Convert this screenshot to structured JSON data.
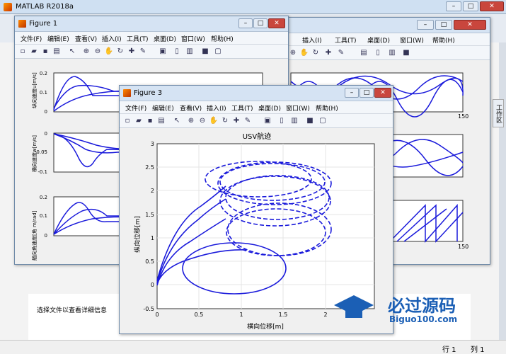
{
  "main": {
    "title": "MATLAB R2018a",
    "status_row": "行 1",
    "status_col": "列 1",
    "select_hint": "选择文件以查看详细信息",
    "workspace_tab": "工作区"
  },
  "menus": [
    "文件(F)",
    "编辑(E)",
    "查看(V)",
    "插入(I)",
    "工具(T)",
    "桌面(D)",
    "窗口(W)",
    "帮助(H)"
  ],
  "fig1": {
    "title": "Figure 1",
    "ylabels": [
      "纵向速度u[m/s]",
      "横向速度w[m/s]",
      "艏向角速度[角 m/rad]"
    ],
    "ax1": {
      "ticks": [
        "0",
        "0.1",
        "0.2"
      ]
    },
    "ax2": {
      "ticks": [
        "0",
        "-0.05",
        "-0.1"
      ]
    },
    "ax3": {
      "ticks": [
        "0",
        "0.1",
        "0.2"
      ]
    },
    "x_end": "150"
  },
  "fig3": {
    "title": "Figure 3",
    "chart_data": {
      "type": "line",
      "title": "USV航迹",
      "xlabel": "横向位移[m]",
      "ylabel": "纵向位移[m]",
      "xlim": [
        0,
        2.2
      ],
      "ylim": [
        -0.5,
        3
      ],
      "xticks": [
        "0",
        "0.5",
        "1",
        "1.5",
        "2"
      ],
      "yticks": [
        "-0.5",
        "0",
        "0.5",
        "1",
        "1.5",
        "2",
        "2.5",
        "3"
      ],
      "grid": true
    }
  },
  "watermark": {
    "text": "必过源码",
    "sub": "Biguo100.com"
  }
}
